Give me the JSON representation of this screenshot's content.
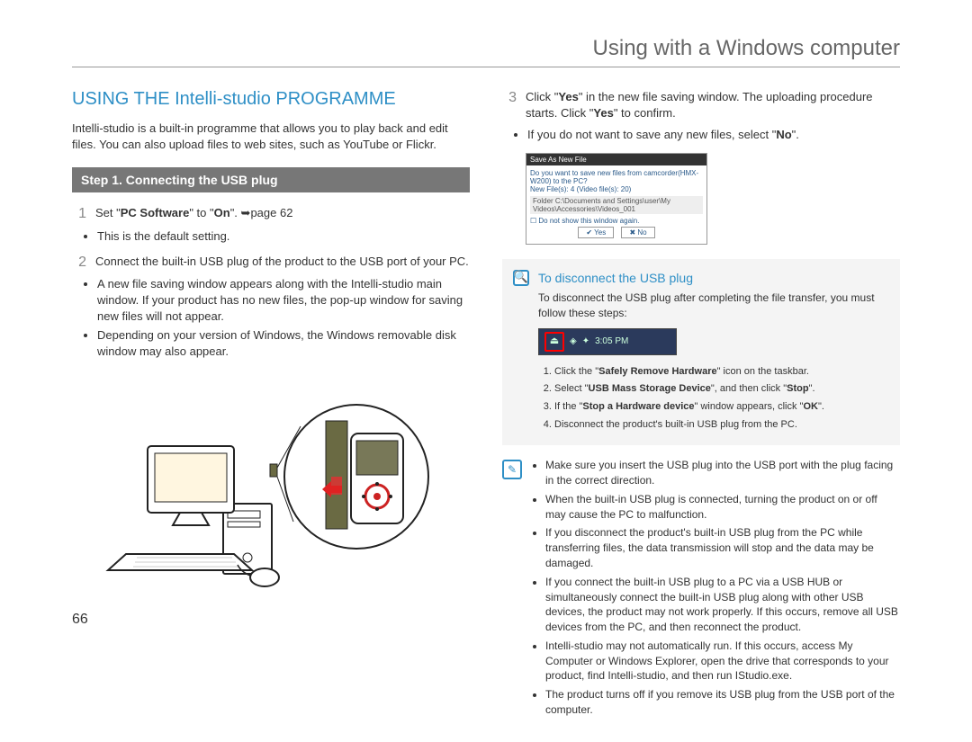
{
  "header": {
    "title": "Using with a Windows computer"
  },
  "page_number": "66",
  "left": {
    "heading": "USING THE Intelli-studio PROGRAMME",
    "intro": "Intelli-studio is a built-in programme that allows you to play back and edit files. You can also upload files to web sites, such as YouTube or Flickr.",
    "step_bar": "Step 1. Connecting the USB plug",
    "step1_num": "1",
    "step1_prefix": "Set \"",
    "step1_pc": "PC Software",
    "step1_mid": "\" to \"",
    "step1_on": "On",
    "step1_suffix": "\". ",
    "step1_page": "page 62",
    "step1_b1": "This is the default setting.",
    "step2_num": "2",
    "step2_text": "Connect the built-in USB plug of the product to the USB port of your PC.",
    "step2_b1": "A new file saving window appears along with the Intelli-studio main window. If your product has no new files, the pop-up window for saving new files will not appear.",
    "step2_b2": "Depending on your version of Windows, the Windows removable disk window may also appear."
  },
  "right": {
    "step3_num": "3",
    "step3_p1": "Click \"",
    "step3_yes1": "Yes",
    "step3_p2": "\" in the new file saving window. The uploading procedure starts. Click \"",
    "step3_yes2": "Yes",
    "step3_p3": "\" to confirm.",
    "step3_b1a": "If you do not want to save any new files, select \"",
    "step3_no": "No",
    "step3_b1b": "\".",
    "dialog": {
      "title": "Save As New File",
      "line1": "Do you want to save new files from camcorder(HMX-W200) to the PC?",
      "line2": "New File(s): 4 (Video file(s): 20)",
      "folder": "Folder      C:\\Documents and Settings\\user\\My Videos\\Accessories\\Videos_001",
      "check": "Do not show this window again.",
      "yes": "Yes",
      "no": "No"
    },
    "disconnect": {
      "title": "To disconnect the USB plug",
      "sub": "To disconnect the USB plug after completing the file transfer, you must follow these steps:",
      "taskbar_time": "3:05 PM",
      "s1a": "Click the \"",
      "s1b": "Safely Remove Hardware",
      "s1c": "\" icon on the taskbar.",
      "s2a": "Select \"",
      "s2b": "USB Mass Storage Device",
      "s2c": "\", and then click \"",
      "s2d": "Stop",
      "s2e": "\".",
      "s3a": "If the \"",
      "s3b": "Stop a Hardware device",
      "s3c": "\" window appears, click \"",
      "s3d": "OK",
      "s3e": "\".",
      "s4": "Disconnect the product's built-in USB plug from the PC."
    },
    "notes": {
      "n1": "Make sure you insert the USB plug into the USB port with the plug facing in the correct direction.",
      "n2": "When the built-in USB plug is connected, turning the product on or off may cause the PC to malfunction.",
      "n3": "If you disconnect the product's built-in USB plug from the PC while transferring files, the data transmission will stop and the data may be damaged.",
      "n4": "If you connect the built-in USB plug to a PC via a USB HUB or simultaneously connect the built-in USB plug along with other USB devices, the product may not work properly. If this occurs, remove all USB devices from the PC, and then reconnect the product.",
      "n5": "Intelli-studio may not automatically run. If this occurs, access My Computer or Windows Explorer, open the drive that corresponds to your product, find Intelli-studio, and then run IStudio.exe.",
      "n6": "The product turns off if you remove its USB plug from the USB port of the computer."
    }
  }
}
